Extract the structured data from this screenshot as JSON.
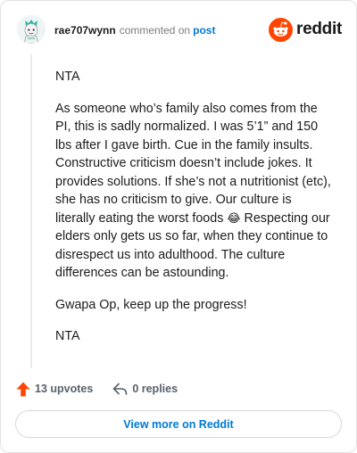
{
  "header": {
    "username": "rae707wynn",
    "action_text": "commented on",
    "post_link": "post",
    "logo_text": "reddit",
    "brand_color": "#ff4500",
    "link_color": "#0079d3"
  },
  "comment": {
    "paragraphs": [
      "NTA",
      "As someone who’s family also comes from the PI, this is sadly normalized. I was 5’1” and 150 lbs after I gave birth. Cue in the family insults. Constructive criticism doesn’t include jokes. It provides solutions. If she’s not a nutritionist (etc), she has no criticism to give. Our culture is literally eating the worst foods",
      "Respecting our elders only gets us so far, when they continue to disrespect us into adulthood. The culture differences can be astounding.",
      "Gwapa Op, keep up the progress!",
      "NTA"
    ],
    "emoji": "😂"
  },
  "actions": {
    "upvotes": "13 upvotes",
    "replies": "0 replies",
    "upvote_icon": "upvote-arrow-icon",
    "reply_icon": "reply-arrow-icon",
    "upvote_color": "#ff4500"
  },
  "footer": {
    "view_more_label": "View more on Reddit"
  }
}
